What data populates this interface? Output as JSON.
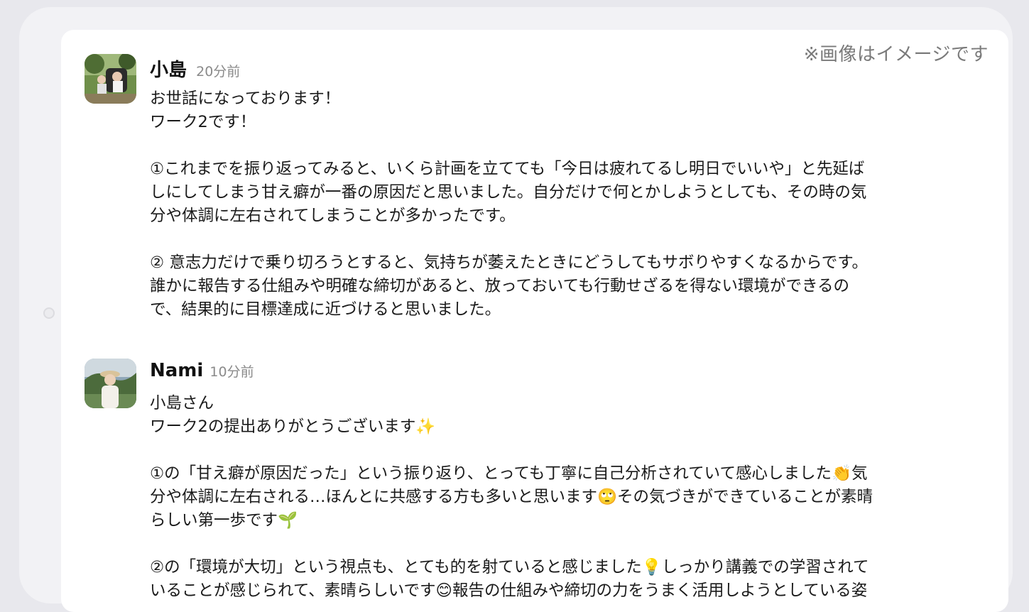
{
  "disclaimer": "※画像はイメージです",
  "posts": [
    {
      "author": "小島",
      "time": "20分前",
      "lines": [
        "お世話になっております！",
        "ワーク2です！",
        "",
        "①これまでを振り返ってみると、いくら計画を立てても「今日は疲れてるし明日でいいや」と先延ば",
        "しにしてしまう甘え癖が一番の原因だと思いました。自分だけで何とかしようとしても、その時の気",
        "分や体調に左右されてしまうことが多かったです。",
        "",
        "② 意志力だけで乗り切ろうとすると、気持ちが萎えたときにどうしてもサボりやすくなるからです。",
        "誰かに報告する仕組みや明確な締切があると、放っておいても行動せざるを得ない環境ができるの",
        "で、結果的に目標達成に近づけると思いました。"
      ]
    },
    {
      "author": "Nami",
      "time": "10分前",
      "lines": [
        "小島さん",
        "ワーク2の提出ありがとうございます✨",
        "",
        "①の「甘え癖が原因だった」という振り返り、とっても丁寧に自己分析されていて感心しました👏気",
        "分や体調に左右される…ほんとに共感する方も多いと思います🙄その気づきができていることが素晴",
        "らしい第一歩です🌱",
        "",
        "②の「環境が大切」という視点も、とても的を射ていると感じました💡しっかり講義での学習されて",
        "いることが感じられて、素晴らしいです😊報告の仕組みや締切の力をうまく活用しようとしている姿"
      ]
    }
  ]
}
